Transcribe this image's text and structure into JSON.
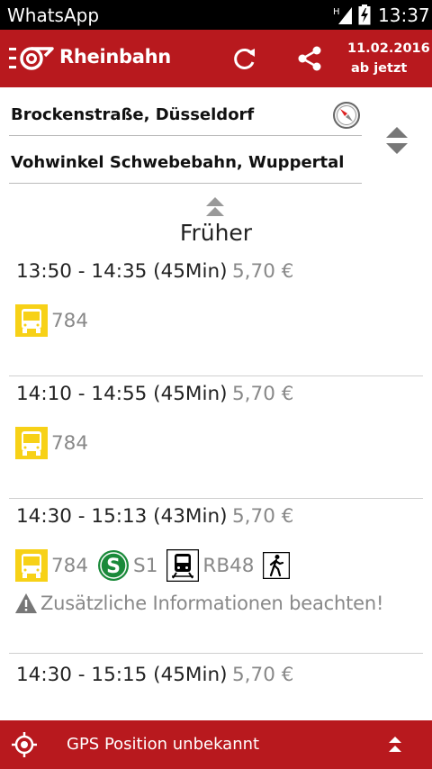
{
  "status_bar": {
    "app_name": "WhatsApp",
    "time": "13:37",
    "signal_icon": "signal-h-icon",
    "battery_icon": "battery-charging-icon"
  },
  "app_bar": {
    "brand": "Rheinbahn",
    "logo_icon": "rheinbahn-logo-icon",
    "refresh_icon": "refresh-icon",
    "share_icon": "share-icon",
    "date": "11.02.2016",
    "time_mode": "ab jetzt",
    "color": "#b8191e"
  },
  "route": {
    "from": "Brockenstraße, Düsseldorf",
    "to": "Vohwinkel Schwebebahn, Wuppertal",
    "compass_icon": "compass-icon",
    "swap_icon": "swap-icon"
  },
  "earlier": {
    "label": "Früher",
    "icon": "chevron-double-up-icon"
  },
  "connections": [
    {
      "time": "13:50 - 14:35 (45Min)",
      "price": "5,70 €",
      "legs": [
        {
          "mode": "bus",
          "icon": "bus-icon",
          "line": "784"
        }
      ],
      "notice": ""
    },
    {
      "time": "14:10 - 14:55 (45Min)",
      "price": "5,70 €",
      "legs": [
        {
          "mode": "bus",
          "icon": "bus-icon",
          "line": "784"
        }
      ],
      "notice": ""
    },
    {
      "time": "14:30 - 15:13 (43Min)",
      "price": "5,70 €",
      "legs": [
        {
          "mode": "bus",
          "icon": "bus-icon",
          "line": "784"
        },
        {
          "mode": "sbahn",
          "icon": "s-bahn-icon",
          "line": "S1"
        },
        {
          "mode": "train",
          "icon": "regional-train-icon",
          "line": "RB48"
        },
        {
          "mode": "walk",
          "icon": "walk-icon",
          "line": ""
        }
      ],
      "notice": "Zusätzliche Informationen beachten!"
    },
    {
      "time": "14:30 - 15:15 (45Min)",
      "price": "5,70 €",
      "legs": [],
      "notice": ""
    }
  ],
  "bottom_bar": {
    "gps_icon": "gps-target-icon",
    "label": "GPS Position unbekannt",
    "expand_icon": "chevron-double-up-icon"
  },
  "colors": {
    "brand_red": "#b8191e",
    "bus_yellow": "#f7d117",
    "sbahn_green": "#1a8a3a",
    "muted_text": "#888888"
  }
}
